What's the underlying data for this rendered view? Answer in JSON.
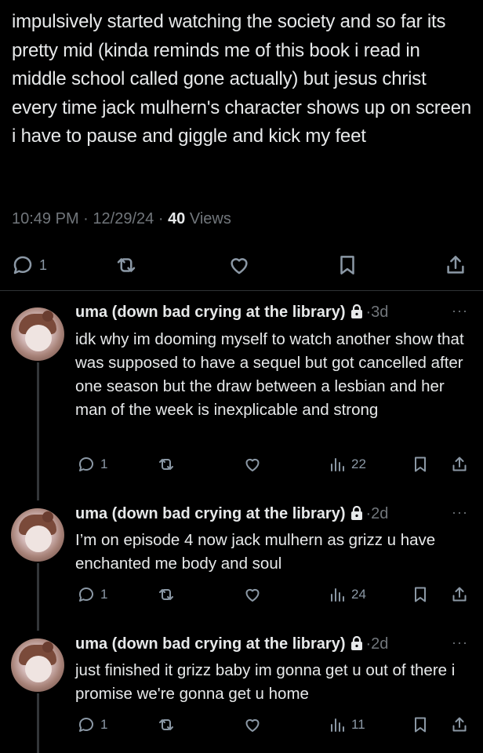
{
  "main_post": {
    "text": "impulsively started watching the society and so far its pretty mid (kinda reminds me of this book i read in middle school called gone actually) but jesus christ every time jack mulhern's character shows up on screen i have to pause and giggle and kick my feet",
    "time": "10:49 PM",
    "date": "12/29/24",
    "sep": "·",
    "views_count": "40",
    "views_label": "Views",
    "reply_count": "1"
  },
  "replies": [
    {
      "author": "uma (down bad crying at the library)",
      "time": "·3d",
      "text": "idk why im dooming myself to watch another show that was supposed to have a sequel but got cancelled after one season but the draw between a lesbian and her man of the week is inexplicable and strong",
      "reply_count": "1",
      "views": "22"
    },
    {
      "author": "uma (down bad crying at the library)",
      "time": "·2d",
      "text": "I’m on episode 4 now jack mulhern as grizz u have enchanted me body and soul",
      "reply_count": "1",
      "views": "24"
    },
    {
      "author": "uma (down bad crying at the library)",
      "time": "·2d",
      "text": "just finished it grizz baby im gonna get u out of there i promise we're gonna get u home",
      "reply_count": "1",
      "views": "11"
    }
  ],
  "more_label": "···",
  "icons": {
    "reply": "reply-icon",
    "repost": "repost-icon",
    "like": "heart-icon",
    "views": "analytics-icon",
    "bookmark": "bookmark-icon",
    "share": "share-icon",
    "lock": "lock-icon"
  }
}
